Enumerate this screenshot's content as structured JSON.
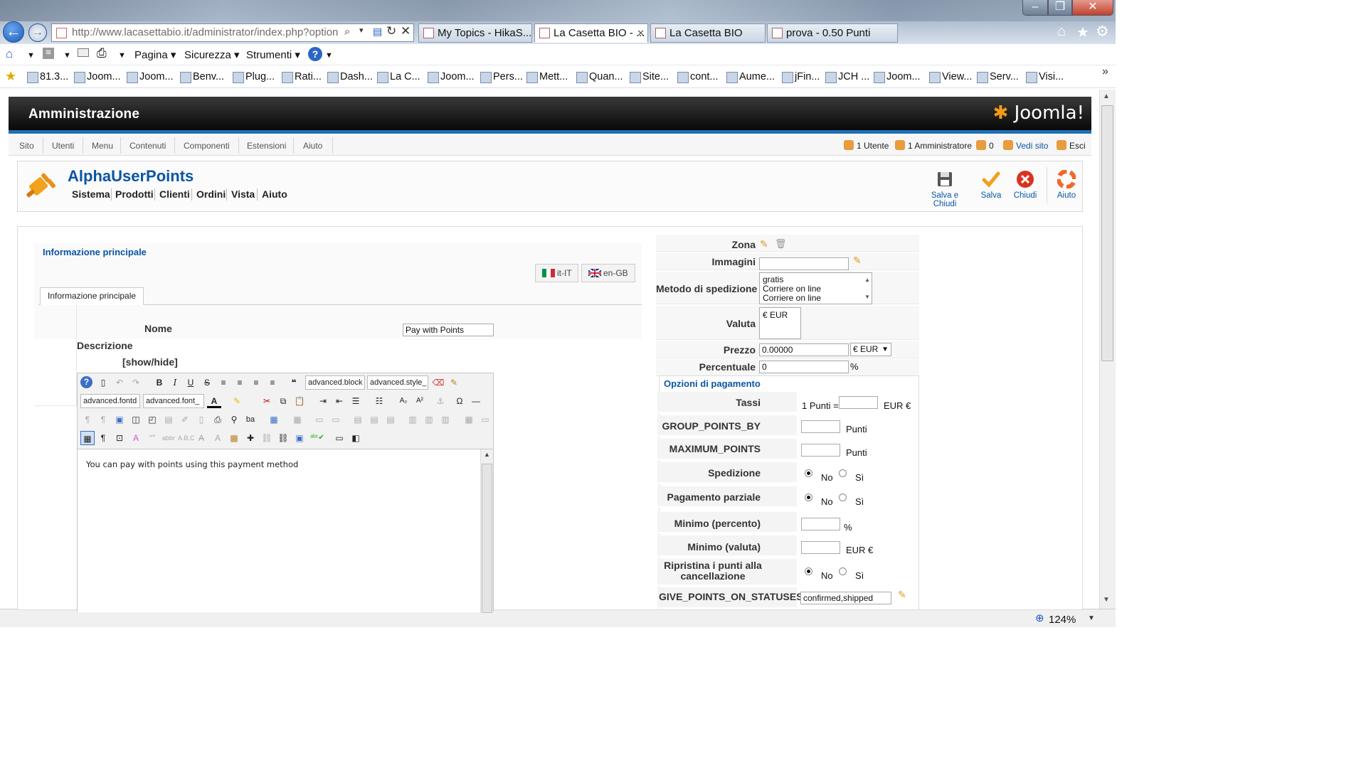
{
  "browser": {
    "address": "http://www.lacasettabio.it/administrator/index.php?option",
    "tabs": [
      "My Topics - HikaS...",
      "La Casetta BIO - ...",
      "La Casetta BIO",
      "prova - 0.50 Punti"
    ],
    "menu": [
      "Pagina",
      "Sicurezza",
      "Strumenti"
    ],
    "favorites": [
      "81.3...",
      "Joom...",
      "Joom...",
      "Benv...",
      "Plug...",
      "Rati...",
      "Dash...",
      "La C...",
      "Joom...",
      "Pers...",
      "Mett...",
      "Quan...",
      "Site...",
      "cont...",
      "Aume...",
      "jFin...",
      "JCH ...",
      "Joom...",
      "View...",
      "Serv...",
      "Visi..."
    ],
    "zoom": "124%"
  },
  "admin": {
    "title": "Amministrazione",
    "logo": "Joomla!",
    "menu": [
      "Sito",
      "Utenti",
      "Menu",
      "Contenuti",
      "Componenti",
      "Estensioni",
      "Aiuto"
    ],
    "status": {
      "users": "1 Utente",
      "admins": "1 Amministratore",
      "messages": "0",
      "view_site": "Vedi sito",
      "logout": "Esci"
    }
  },
  "component": {
    "title": "AlphaUserPoints",
    "submenu": [
      "Sistema",
      "Prodotti",
      "Clienti",
      "Ordini",
      "Vista",
      "Aiuto"
    ],
    "toolbar": {
      "save_close": "Salva e Chiudi",
      "save": "Salva",
      "close": "Chiudi",
      "help": "Aiuto"
    }
  },
  "main": {
    "section_title": "Informazione principale",
    "lang_it": "it-IT",
    "lang_en": "en-GB",
    "tab_label": "Informazione principale",
    "name_label": "Nome",
    "name_value": "Pay with Points",
    "desc_label": "Descrizione",
    "showhide": "[show/hide]",
    "editor_selects": [
      "advanced.block",
      "advanced.style_",
      "advanced.fontd",
      "advanced.font_"
    ],
    "editor_text": "You can pay with points using this payment method"
  },
  "right": {
    "zone_label": "Zona",
    "images_label": "Immagini",
    "shipping_label": "Metodo di spedizione",
    "shipping_options": [
      "gratis",
      "Corriere on line",
      "Corriere on line"
    ],
    "currency_label": "Valuta",
    "currency_value": "€ EUR",
    "price_label": "Prezzo",
    "price_value": "0.00000",
    "price_currency": "€ EUR",
    "percent_label": "Percentuale",
    "percent_value": "0",
    "percent_sign": "%"
  },
  "payment": {
    "legend": "Opzioni di pagamento",
    "rows": {
      "tassi": "Tassi",
      "tassi_prefix": "1 Punti =",
      "tassi_suffix": "EUR €",
      "group": "GROUP_POINTS_BY",
      "group_unit": "Punti",
      "max": "MAXIMUM_POINTS",
      "max_unit": "Punti",
      "ship": "Spedizione",
      "partial": "Pagamento parziale",
      "minpct": "Minimo (percento)",
      "minpct_unit": "%",
      "mincur": "Minimo (valuta)",
      "mincur_unit": "EUR €",
      "restore": "Ripristina i punti alla cancellazione",
      "give": "GIVE_POINTS_ON_STATUSES",
      "give_value": "confirmed,shipped"
    },
    "no": "No",
    "yes": "Sì"
  }
}
